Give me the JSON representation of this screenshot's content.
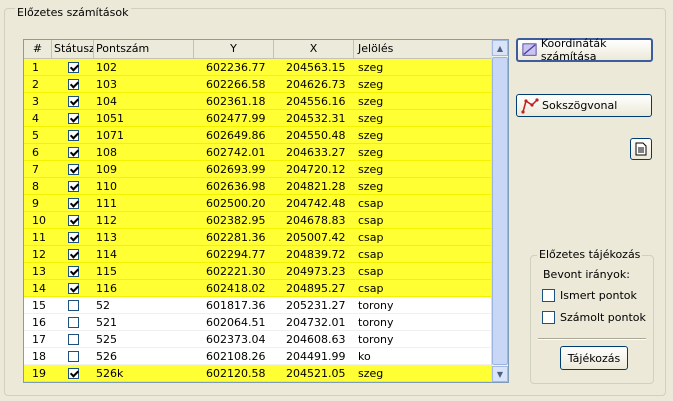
{
  "group_title": "Előzetes számítások",
  "grid": {
    "columns": [
      "#",
      "Státusz",
      "Pontszám",
      "Y",
      "X",
      "Jelölés"
    ],
    "rows": [
      {
        "n": "1",
        "checked": true,
        "pt": "102",
        "y": "602236.77",
        "x": "204563.15",
        "j": "szeg",
        "sel": true
      },
      {
        "n": "2",
        "checked": true,
        "pt": "103",
        "y": "602266.58",
        "x": "204626.73",
        "j": "szeg",
        "sel": true
      },
      {
        "n": "3",
        "checked": true,
        "pt": "104",
        "y": "602361.18",
        "x": "204556.16",
        "j": "szeg",
        "sel": true
      },
      {
        "n": "4",
        "checked": true,
        "pt": "1051",
        "y": "602477.99",
        "x": "204532.31",
        "j": "szeg",
        "sel": true
      },
      {
        "n": "5",
        "checked": true,
        "pt": "1071",
        "y": "602649.86",
        "x": "204550.48",
        "j": "szeg",
        "sel": true
      },
      {
        "n": "6",
        "checked": true,
        "pt": "108",
        "y": "602742.01",
        "x": "204633.27",
        "j": "szeg",
        "sel": true
      },
      {
        "n": "7",
        "checked": true,
        "pt": "109",
        "y": "602693.99",
        "x": "204720.12",
        "j": "szeg",
        "sel": true
      },
      {
        "n": "8",
        "checked": true,
        "pt": "110",
        "y": "602636.98",
        "x": "204821.28",
        "j": "szeg",
        "sel": true
      },
      {
        "n": "9",
        "checked": true,
        "pt": "111",
        "y": "602500.20",
        "x": "204742.48",
        "j": "csap",
        "sel": true
      },
      {
        "n": "10",
        "checked": true,
        "pt": "112",
        "y": "602382.95",
        "x": "204678.83",
        "j": "csap",
        "sel": true
      },
      {
        "n": "11",
        "checked": true,
        "pt": "113",
        "y": "602281.36",
        "x": "205007.42",
        "j": "csap",
        "sel": true
      },
      {
        "n": "12",
        "checked": true,
        "pt": "114",
        "y": "602294.77",
        "x": "204839.72",
        "j": "csap",
        "sel": true
      },
      {
        "n": "13",
        "checked": true,
        "pt": "115",
        "y": "602221.30",
        "x": "204973.23",
        "j": "csap",
        "sel": true
      },
      {
        "n": "14",
        "checked": true,
        "pt": "116",
        "y": "602418.02",
        "x": "204895.27",
        "j": "csap",
        "sel": true
      },
      {
        "n": "15",
        "checked": false,
        "pt": "52",
        "y": "601817.36",
        "x": "205231.27",
        "j": "torony",
        "sel": false
      },
      {
        "n": "16",
        "checked": false,
        "pt": "521",
        "y": "602064.51",
        "x": "204732.01",
        "j": "torony",
        "sel": false
      },
      {
        "n": "17",
        "checked": false,
        "pt": "525",
        "y": "602373.04",
        "x": "204608.63",
        "j": "torony",
        "sel": false
      },
      {
        "n": "18",
        "checked": false,
        "pt": "526",
        "y": "602108.26",
        "x": "204491.99",
        "j": "ko",
        "sel": false
      },
      {
        "n": "19",
        "checked": true,
        "pt": "526k",
        "y": "602120.58",
        "x": "204521.05",
        "j": "szeg",
        "sel": true
      }
    ]
  },
  "buttons": {
    "coord": "Koordináták számítása",
    "poly": "Sokszögvonal",
    "tajek": "Tájékozás"
  },
  "orient_group": {
    "title": "Előzetes tájékozás",
    "bevont": "Bevont irányok:",
    "ismert": "Ismert pontok",
    "szamolt": "Számolt pontok"
  },
  "colors": {
    "selected_row": "#ffff33",
    "window_bg": "#ece9d8"
  },
  "icons": [
    "coordinates-icon",
    "polygon-icon",
    "document-icon",
    "scroll-up-icon",
    "scroll-down-icon"
  ]
}
